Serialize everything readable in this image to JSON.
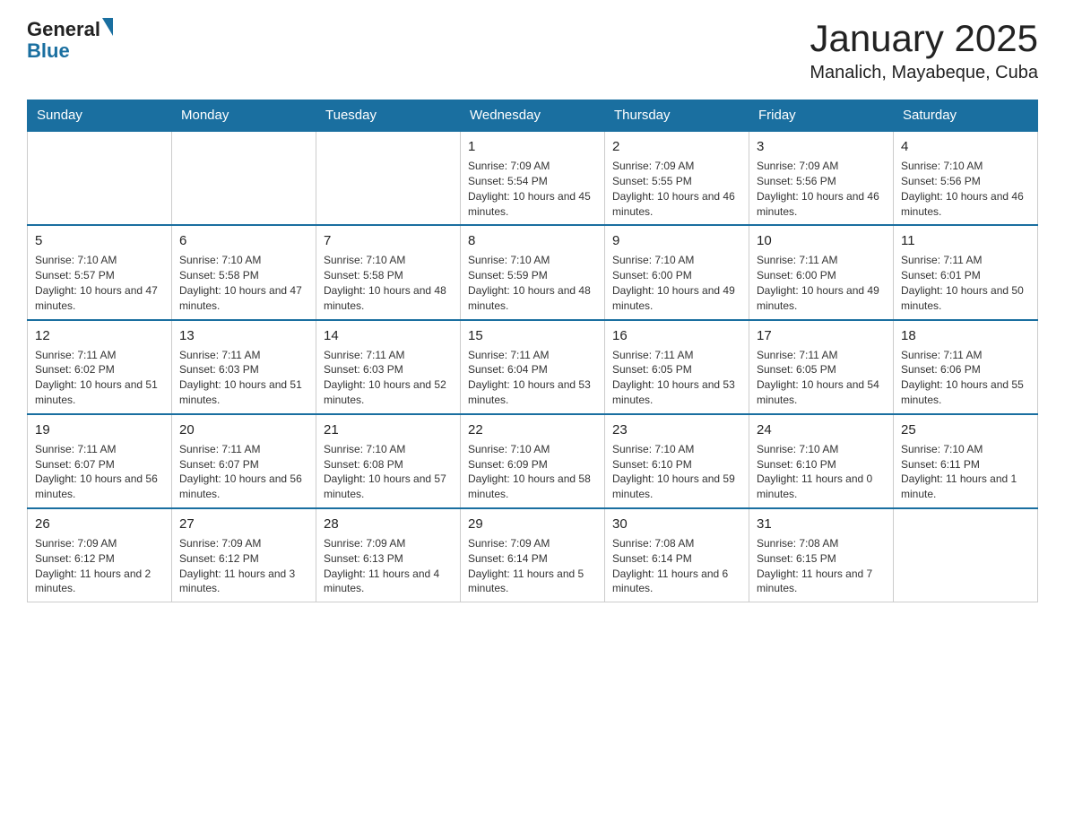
{
  "header": {
    "logo_general": "General",
    "logo_blue": "Blue",
    "title": "January 2025",
    "subtitle": "Manalich, Mayabeque, Cuba"
  },
  "calendar": {
    "days_of_week": [
      "Sunday",
      "Monday",
      "Tuesday",
      "Wednesday",
      "Thursday",
      "Friday",
      "Saturday"
    ],
    "weeks": [
      [
        {
          "day": "",
          "info": ""
        },
        {
          "day": "",
          "info": ""
        },
        {
          "day": "",
          "info": ""
        },
        {
          "day": "1",
          "info": "Sunrise: 7:09 AM\nSunset: 5:54 PM\nDaylight: 10 hours and 45 minutes."
        },
        {
          "day": "2",
          "info": "Sunrise: 7:09 AM\nSunset: 5:55 PM\nDaylight: 10 hours and 46 minutes."
        },
        {
          "day": "3",
          "info": "Sunrise: 7:09 AM\nSunset: 5:56 PM\nDaylight: 10 hours and 46 minutes."
        },
        {
          "day": "4",
          "info": "Sunrise: 7:10 AM\nSunset: 5:56 PM\nDaylight: 10 hours and 46 minutes."
        }
      ],
      [
        {
          "day": "5",
          "info": "Sunrise: 7:10 AM\nSunset: 5:57 PM\nDaylight: 10 hours and 47 minutes."
        },
        {
          "day": "6",
          "info": "Sunrise: 7:10 AM\nSunset: 5:58 PM\nDaylight: 10 hours and 47 minutes."
        },
        {
          "day": "7",
          "info": "Sunrise: 7:10 AM\nSunset: 5:58 PM\nDaylight: 10 hours and 48 minutes."
        },
        {
          "day": "8",
          "info": "Sunrise: 7:10 AM\nSunset: 5:59 PM\nDaylight: 10 hours and 48 minutes."
        },
        {
          "day": "9",
          "info": "Sunrise: 7:10 AM\nSunset: 6:00 PM\nDaylight: 10 hours and 49 minutes."
        },
        {
          "day": "10",
          "info": "Sunrise: 7:11 AM\nSunset: 6:00 PM\nDaylight: 10 hours and 49 minutes."
        },
        {
          "day": "11",
          "info": "Sunrise: 7:11 AM\nSunset: 6:01 PM\nDaylight: 10 hours and 50 minutes."
        }
      ],
      [
        {
          "day": "12",
          "info": "Sunrise: 7:11 AM\nSunset: 6:02 PM\nDaylight: 10 hours and 51 minutes."
        },
        {
          "day": "13",
          "info": "Sunrise: 7:11 AM\nSunset: 6:03 PM\nDaylight: 10 hours and 51 minutes."
        },
        {
          "day": "14",
          "info": "Sunrise: 7:11 AM\nSunset: 6:03 PM\nDaylight: 10 hours and 52 minutes."
        },
        {
          "day": "15",
          "info": "Sunrise: 7:11 AM\nSunset: 6:04 PM\nDaylight: 10 hours and 53 minutes."
        },
        {
          "day": "16",
          "info": "Sunrise: 7:11 AM\nSunset: 6:05 PM\nDaylight: 10 hours and 53 minutes."
        },
        {
          "day": "17",
          "info": "Sunrise: 7:11 AM\nSunset: 6:05 PM\nDaylight: 10 hours and 54 minutes."
        },
        {
          "day": "18",
          "info": "Sunrise: 7:11 AM\nSunset: 6:06 PM\nDaylight: 10 hours and 55 minutes."
        }
      ],
      [
        {
          "day": "19",
          "info": "Sunrise: 7:11 AM\nSunset: 6:07 PM\nDaylight: 10 hours and 56 minutes."
        },
        {
          "day": "20",
          "info": "Sunrise: 7:11 AM\nSunset: 6:07 PM\nDaylight: 10 hours and 56 minutes."
        },
        {
          "day": "21",
          "info": "Sunrise: 7:10 AM\nSunset: 6:08 PM\nDaylight: 10 hours and 57 minutes."
        },
        {
          "day": "22",
          "info": "Sunrise: 7:10 AM\nSunset: 6:09 PM\nDaylight: 10 hours and 58 minutes."
        },
        {
          "day": "23",
          "info": "Sunrise: 7:10 AM\nSunset: 6:10 PM\nDaylight: 10 hours and 59 minutes."
        },
        {
          "day": "24",
          "info": "Sunrise: 7:10 AM\nSunset: 6:10 PM\nDaylight: 11 hours and 0 minutes."
        },
        {
          "day": "25",
          "info": "Sunrise: 7:10 AM\nSunset: 6:11 PM\nDaylight: 11 hours and 1 minute."
        }
      ],
      [
        {
          "day": "26",
          "info": "Sunrise: 7:09 AM\nSunset: 6:12 PM\nDaylight: 11 hours and 2 minutes."
        },
        {
          "day": "27",
          "info": "Sunrise: 7:09 AM\nSunset: 6:12 PM\nDaylight: 11 hours and 3 minutes."
        },
        {
          "day": "28",
          "info": "Sunrise: 7:09 AM\nSunset: 6:13 PM\nDaylight: 11 hours and 4 minutes."
        },
        {
          "day": "29",
          "info": "Sunrise: 7:09 AM\nSunset: 6:14 PM\nDaylight: 11 hours and 5 minutes."
        },
        {
          "day": "30",
          "info": "Sunrise: 7:08 AM\nSunset: 6:14 PM\nDaylight: 11 hours and 6 minutes."
        },
        {
          "day": "31",
          "info": "Sunrise: 7:08 AM\nSunset: 6:15 PM\nDaylight: 11 hours and 7 minutes."
        },
        {
          "day": "",
          "info": ""
        }
      ]
    ]
  }
}
